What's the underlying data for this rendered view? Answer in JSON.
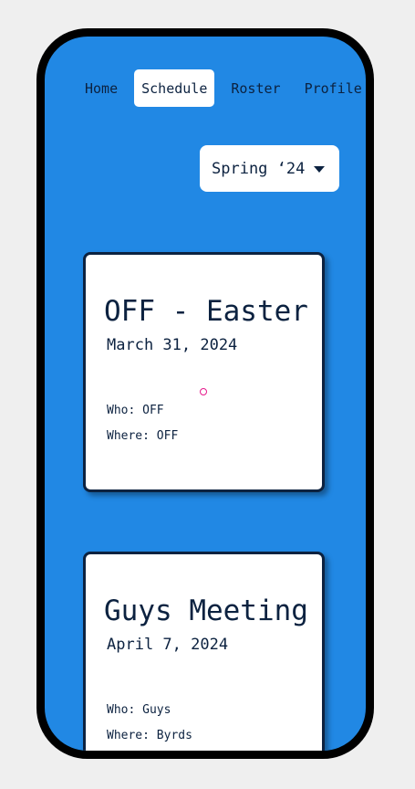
{
  "nav": {
    "items": [
      {
        "label": "Home",
        "active": false
      },
      {
        "label": "Schedule",
        "active": true
      },
      {
        "label": "Roster",
        "active": false
      },
      {
        "label": "Profile",
        "active": false
      }
    ]
  },
  "season_select": {
    "selected": "Spring ‘24",
    "icon": "chevron-down-icon"
  },
  "events": [
    {
      "title": "OFF - Easter",
      "date": "March 31, 2024",
      "who": "Who: OFF",
      "where": "Where: OFF"
    },
    {
      "title": "Guys Meeting",
      "date": "April 7, 2024",
      "who": "Who: Guys",
      "where": "Where: Byrds"
    }
  ],
  "colors": {
    "background": "#2188e4",
    "card": "#ffffff",
    "text": "#0c2240",
    "frame": "#000000",
    "page": "#efefef",
    "cursor": "#e6198c"
  }
}
